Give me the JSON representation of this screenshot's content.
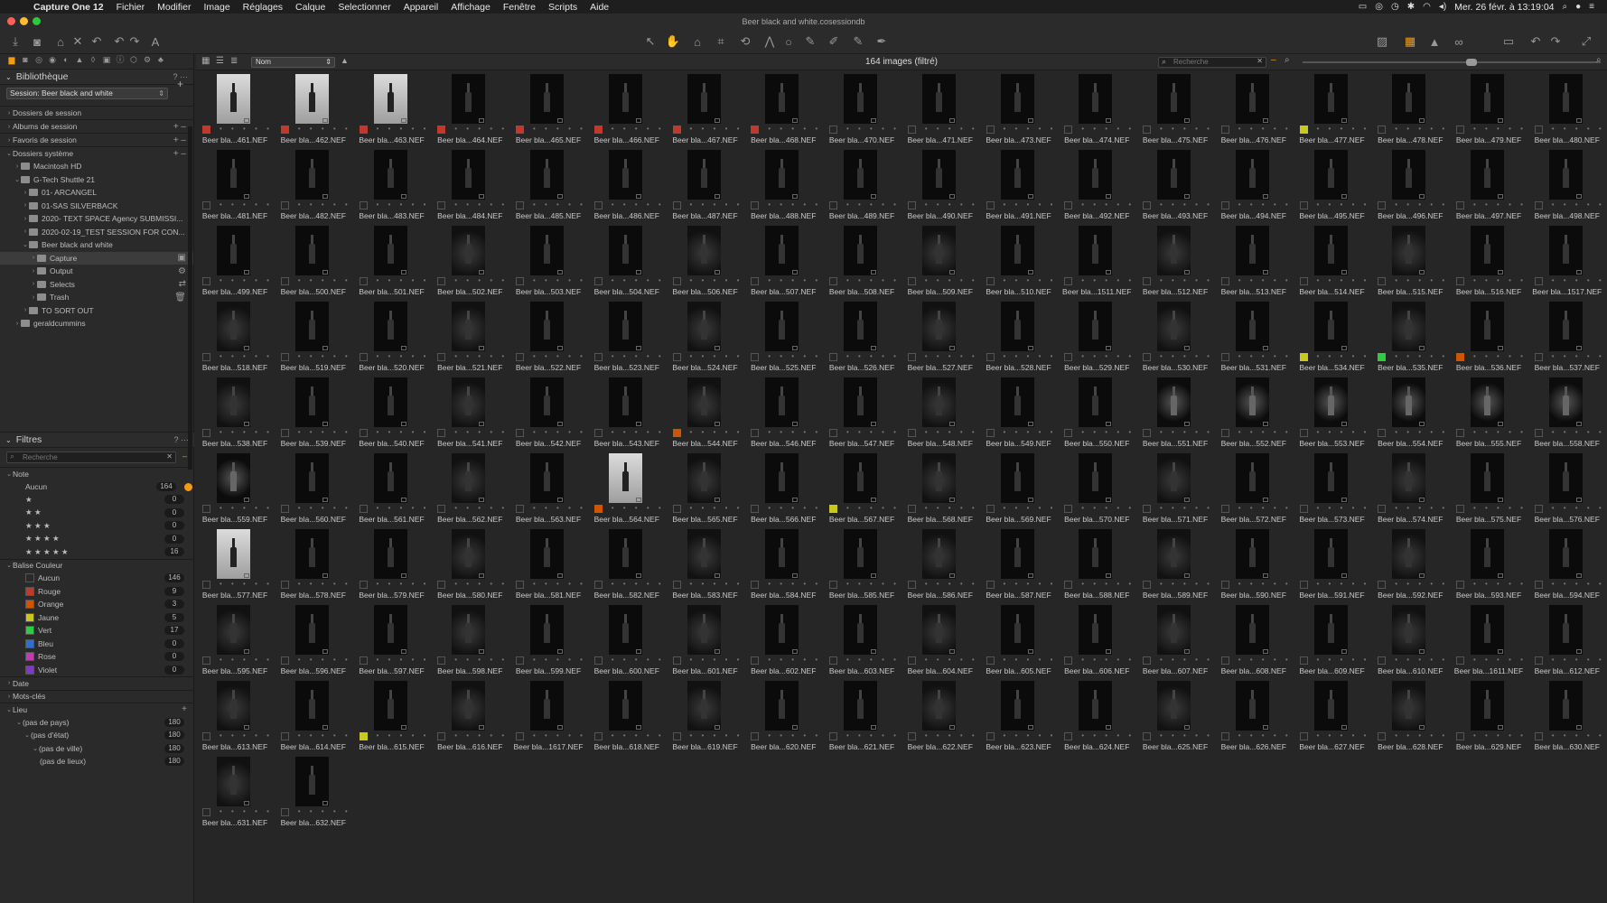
{
  "menubar": {
    "app": "Capture One 12",
    "items": [
      "Fichier",
      "Modifier",
      "Image",
      "Réglages",
      "Calque",
      "Selectionner",
      "Appareil",
      "Affichage",
      "Fenêtre",
      "Scripts",
      "Aide"
    ],
    "datetime": "Mer. 26 févr. à 13:19:04"
  },
  "titlebar": {
    "title": "Beer black and white.cosessiondb"
  },
  "library": {
    "title": "Bibliothèque",
    "help": "? ···",
    "session_select": "Session: Beer black and white",
    "rows": [
      {
        "label": "Dossiers de session",
        "indent": 0,
        "arrow": "›",
        "action": ""
      },
      {
        "label": "Albums de session",
        "indent": 0,
        "arrow": "›",
        "action": "+ –"
      },
      {
        "label": "Favoris de session",
        "indent": 0,
        "arrow": "›",
        "action": "+ –"
      },
      {
        "label": "Dossiers système",
        "indent": 0,
        "arrow": "⌄",
        "action": "+ –"
      },
      {
        "label": "Macintosh HD",
        "indent": 1,
        "arrow": "›",
        "action": ""
      },
      {
        "label": "G-Tech Shuttle 21",
        "indent": 1,
        "arrow": "⌄",
        "action": ""
      },
      {
        "label": "01- ARCANGEL",
        "indent": 2,
        "arrow": "›",
        "action": ""
      },
      {
        "label": "01-SAS SILVERBACK",
        "indent": 2,
        "arrow": "›",
        "action": ""
      },
      {
        "label": "2020- TEXT SPACE Agency SUBMISSI...",
        "indent": 2,
        "arrow": "›",
        "action": ""
      },
      {
        "label": "2020-02-19_TEST SESSION FOR CON...",
        "indent": 2,
        "arrow": "›",
        "action": ""
      },
      {
        "label": "Beer black and white",
        "indent": 2,
        "arrow": "⌄",
        "action": ""
      },
      {
        "label": "Capture",
        "indent": 3,
        "arrow": "›",
        "action": "▣",
        "selected": true
      },
      {
        "label": "Output",
        "indent": 3,
        "arrow": "›",
        "action": "⚙"
      },
      {
        "label": "Selects",
        "indent": 3,
        "arrow": "›",
        "action": "⇄"
      },
      {
        "label": "Trash",
        "indent": 3,
        "arrow": "›",
        "action": "🗑"
      },
      {
        "label": "TO SORT OUT",
        "indent": 2,
        "arrow": "›",
        "action": ""
      },
      {
        "label": "geraldcummins",
        "indent": 1,
        "arrow": "›",
        "action": ""
      }
    ]
  },
  "filters": {
    "title": "Filtres",
    "help": "? ···",
    "search_placeholder": "Recherche",
    "note_title": "Note",
    "ratings": [
      {
        "label": "Aucun",
        "count": "164"
      },
      {
        "label": "★",
        "count": "0"
      },
      {
        "label": "★ ★",
        "count": "0"
      },
      {
        "label": "★ ★ ★",
        "count": "0"
      },
      {
        "label": "★ ★ ★ ★",
        "count": "0"
      },
      {
        "label": "★ ★ ★ ★ ★",
        "count": "16"
      }
    ],
    "color_title": "Balise Couleur",
    "colors": [
      {
        "label": "Aucun",
        "count": "146",
        "color": "#2a2a2a"
      },
      {
        "label": "Rouge",
        "count": "9",
        "color": "#c0392b"
      },
      {
        "label": "Orange",
        "count": "3",
        "color": "#d35400"
      },
      {
        "label": "Jaune",
        "count": "5",
        "color": "#c8c81e"
      },
      {
        "label": "Vert",
        "count": "17",
        "color": "#2ecc40"
      },
      {
        "label": "Bleu",
        "count": "0",
        "color": "#2d6fd1"
      },
      {
        "label": "Rose",
        "count": "0",
        "color": "#c43ab2"
      },
      {
        "label": "Violet",
        "count": "0",
        "color": "#7d3ac4"
      }
    ],
    "date_title": "Date",
    "keywords_title": "Mots-clés",
    "place_title": "Lieu",
    "places": [
      {
        "label": "(pas de pays)",
        "count": "180",
        "indent": 1
      },
      {
        "label": "(pas d'état)",
        "count": "180",
        "indent": 2
      },
      {
        "label": "(pas de ville)",
        "count": "180",
        "indent": 3
      },
      {
        "label": "(pas de lieux)",
        "count": "180",
        "indent": 4
      }
    ]
  },
  "browser": {
    "sort": "Nom",
    "count_label": "164 images (filtré)",
    "search_placeholder": "Recherche",
    "names": [
      "461",
      "462",
      "463",
      "464",
      "465",
      "466",
      "467",
      "468",
      "470",
      "471",
      "473",
      "474",
      "475",
      "476",
      "477",
      "478",
      "479",
      "480",
      "481",
      "482",
      "483",
      "484",
      "485",
      "486",
      "487",
      "488",
      "489",
      "490",
      "491",
      "492",
      "493",
      "494",
      "495",
      "496",
      "497",
      "498",
      "499",
      "500",
      "501",
      "502",
      "503",
      "504",
      "506",
      "507",
      "508",
      "509",
      "510",
      "1511",
      "512",
      "513",
      "514",
      "515",
      "516",
      "1517",
      "518",
      "519",
      "520",
      "521",
      "522",
      "523",
      "524",
      "525",
      "526",
      "527",
      "528",
      "529",
      "530",
      "531",
      "534",
      "535",
      "536",
      "537",
      "538",
      "539",
      "540",
      "541",
      "542",
      "543",
      "544",
      "546",
      "547",
      "548",
      "549",
      "550",
      "551",
      "552",
      "553",
      "554",
      "555",
      "558",
      "559",
      "560",
      "561",
      "562",
      "563",
      "564",
      "565",
      "566",
      "567",
      "568",
      "569",
      "570",
      "571",
      "572",
      "573",
      "574",
      "575",
      "576",
      "577",
      "578",
      "579",
      "580",
      "581",
      "582",
      "583",
      "584",
      "585",
      "586",
      "587",
      "588",
      "589",
      "590",
      "591",
      "592",
      "593",
      "594",
      "595",
      "596",
      "597",
      "598",
      "599",
      "600",
      "601",
      "602",
      "603",
      "604",
      "605",
      "606",
      "607",
      "608",
      "609",
      "610",
      "1611",
      "612",
      "613",
      "614",
      "615",
      "616",
      "1617",
      "618",
      "619",
      "620",
      "621",
      "622",
      "623",
      "624",
      "625",
      "626",
      "627",
      "628",
      "629",
      "630",
      "631",
      "632"
    ],
    "prefix": "Beer bla...",
    "suffix": ".NEF",
    "stars": "• • • • •",
    "tags": {
      "0": "#c0392b",
      "1": "#c0392b",
      "2": "#c0392b",
      "3": "#c0392b",
      "4": "#c0392b",
      "5": "#c0392b",
      "6": "#c0392b",
      "7": "#c0392b",
      "14": "#c8c81e",
      "68": "#c8c81e",
      "69": "#2ecc40",
      "70": "#d35400",
      "78": "#d35400",
      "95": "#d35400",
      "98": "#c8c81e",
      "146": "#c8c81e",
      "164": "#c8c81e"
    },
    "light": [
      0,
      1,
      2,
      95,
      108
    ],
    "lit": [
      84,
      85,
      86,
      87,
      88,
      89,
      90
    ]
  }
}
